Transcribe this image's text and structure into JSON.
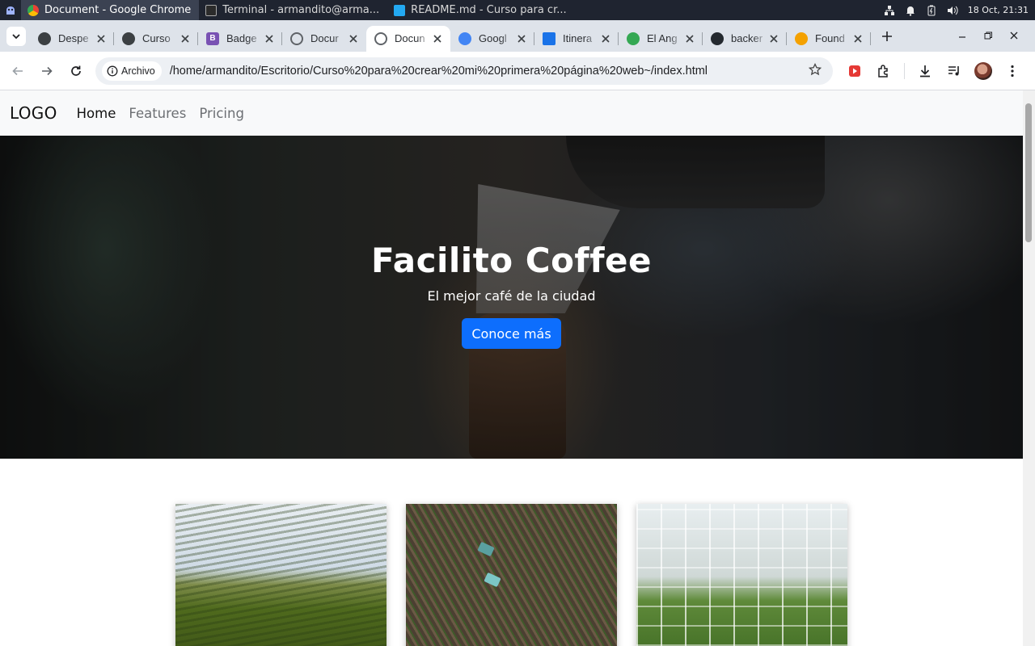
{
  "os": {
    "tasks": [
      {
        "label": "Document - Google Chrome",
        "active": true,
        "icon": "chrome-icon"
      },
      {
        "label": "Terminal - armandito@arma...",
        "active": false,
        "icon": "terminal-icon"
      },
      {
        "label": "README.md - Curso para cr...",
        "active": false,
        "icon": "vscode-icon"
      }
    ],
    "clock": "18 Oct, 21:31"
  },
  "browser": {
    "tabs": [
      {
        "label": "Despe",
        "icon": "site-icon",
        "color": "#3c4043"
      },
      {
        "label": "Curso",
        "icon": "site-icon",
        "color": "#3c4043"
      },
      {
        "label": "Badge",
        "icon": "bootstrap-icon",
        "color": "#7952b3"
      },
      {
        "label": "Docur",
        "icon": "globe-icon",
        "color": "#5f6368"
      },
      {
        "label": "Docun",
        "icon": "globe-icon",
        "color": "#5f6368",
        "active": true
      },
      {
        "label": "Googl",
        "icon": "gemini-icon",
        "color": "#4285f4"
      },
      {
        "label": "Itinera",
        "icon": "video-icon",
        "color": "#1a73e8"
      },
      {
        "label": "El Ang",
        "icon": "maps-icon",
        "color": "#34a853"
      },
      {
        "label": "backer",
        "icon": "github-icon",
        "color": "#24292f"
      },
      {
        "label": "Found",
        "icon": "site-icon",
        "color": "#f4a100"
      }
    ],
    "omnibox": {
      "chip_label": "Archivo",
      "url": "/home/armandito/Escritorio/Curso%20para%20crear%20mi%20primera%20página%20web~/index.html"
    }
  },
  "site": {
    "brand": "LOGO",
    "nav": [
      {
        "label": "Home",
        "active": true
      },
      {
        "label": "Features",
        "active": false
      },
      {
        "label": "Pricing",
        "active": false
      }
    ],
    "hero": {
      "title": "Facilito Coffee",
      "subtitle": "El mejor café de la ciudad",
      "cta": "Conoce más"
    },
    "cards": [
      {
        "image": "crop-field-image"
      },
      {
        "image": "aerial-tractor-image"
      },
      {
        "image": "greenhouse-image"
      }
    ]
  },
  "colors": {
    "primary_button": "#0d6efd",
    "navbar_bg": "#f8f9fa",
    "tab_strip": "#dee3ea",
    "os_panel": "#1f2430"
  }
}
